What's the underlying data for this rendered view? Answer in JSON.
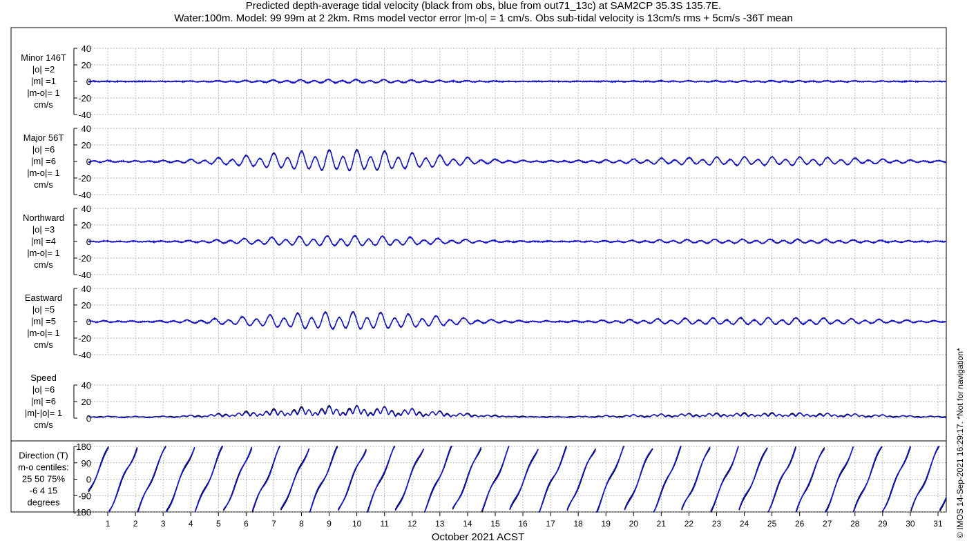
{
  "title_line1": "Predicted depth-average tidal velocity (black from obs, blue from out71_13c) at SAM2CP 35.3S 135.7E.",
  "title_line2": "Water:100m. Model: 99 99m at 2 2km. Rms model vector error |m-o| = 1 cm/s. Obs sub-tidal velocity is 13cm/s rms + 5cm/s -36T mean",
  "copyright": "© IMOS 14-Sep-2021 16:29:17. *Not for navigation*",
  "colors": {
    "obs": "#000000",
    "model": "#1414d2",
    "grid": "#888888"
  },
  "chart_data": {
    "type": "line",
    "xlabel": "October 2021 ACST",
    "x_ticks": [
      "1",
      "2",
      "3",
      "4",
      "5",
      "6",
      "7",
      "8",
      "9",
      "10",
      "11",
      "12",
      "13",
      "14",
      "15",
      "16",
      "17",
      "18",
      "19",
      "20",
      "21",
      "22",
      "23",
      "24",
      "25",
      "26",
      "27",
      "28",
      "29",
      "30",
      "31"
    ],
    "xlim_days": [
      0.3,
      31.3
    ],
    "series_names": [
      "obs",
      "model"
    ],
    "grid": true,
    "panels": [
      {
        "key": "minor",
        "label_lines": [
          "Minor 146T",
          "|o| =2",
          "|m| =1",
          "|m-o|= 1",
          "cm/s"
        ],
        "yticks": [
          "40",
          "20",
          "0",
          "-20",
          "-40"
        ],
        "ylim": [
          -40,
          40
        ],
        "approx_amplitude": 2,
        "envelope": "mixed semidiurnal"
      },
      {
        "key": "major",
        "label_lines": [
          "Major 56T",
          "|o| =6",
          "|m| =6",
          "|m-o|= 1",
          "cm/s"
        ],
        "yticks": [
          "40",
          "20",
          "0",
          "-20",
          "-40"
        ],
        "ylim": [
          -40,
          40
        ],
        "approx_amplitude": 12,
        "envelope": "mixed semidiurnal, strong spring-neap modulation"
      },
      {
        "key": "north",
        "label_lines": [
          "Northward",
          "|o| =3",
          "|m| =4",
          "|m-o|= 1",
          "cm/s"
        ],
        "yticks": [
          "40",
          "20",
          "0",
          "-20",
          "-40"
        ],
        "ylim": [
          -40,
          40
        ],
        "approx_amplitude": 6,
        "envelope": "mixed semidiurnal"
      },
      {
        "key": "east",
        "label_lines": [
          "Eastward",
          "|o| =5",
          "|m| =5",
          "|m-o|= 1",
          "cm/s"
        ],
        "yticks": [
          "40",
          "20",
          "0",
          "-20",
          "-40"
        ],
        "ylim": [
          -40,
          40
        ],
        "approx_amplitude": 10,
        "envelope": "mixed semidiurnal"
      },
      {
        "key": "speed",
        "label_lines": [
          "Speed",
          "|o| =6",
          "|m| =6",
          "|m|-|o|= 1",
          "cm/s"
        ],
        "yticks": [
          "40",
          "20",
          "0"
        ],
        "ylim": [
          0,
          40
        ],
        "approx_amplitude": 12,
        "envelope": "rectified magnitude"
      },
      {
        "key": "direction",
        "label_lines": [
          "Direction (T)",
          "m-o centiles:",
          "25  50  75%",
          "-6   4  15",
          "degrees"
        ],
        "yticks": [
          "180",
          "90",
          "0",
          "-90",
          "-180"
        ],
        "ylim": [
          -180,
          180
        ],
        "envelope": "rotating direction, wraps at ±180"
      }
    ]
  }
}
